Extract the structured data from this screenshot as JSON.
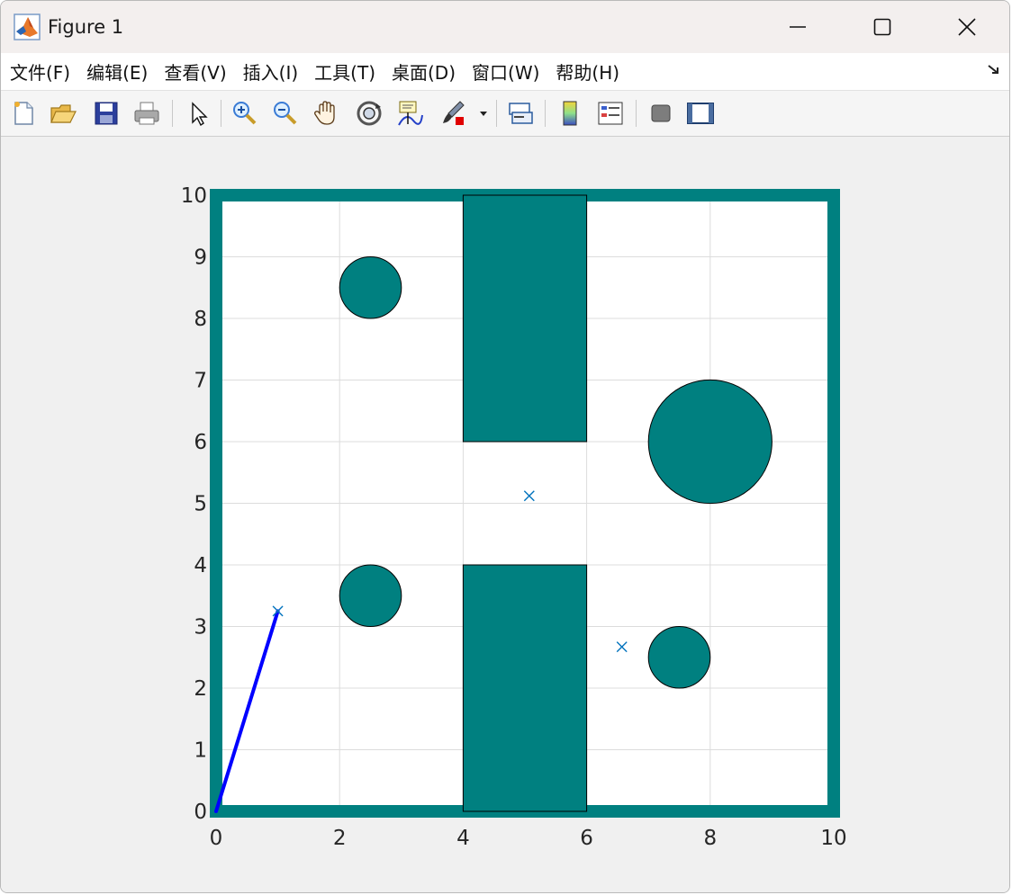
{
  "window": {
    "title": "Figure 1",
    "controls": {
      "minimize": "minimize",
      "maximize": "maximize",
      "close": "close"
    }
  },
  "menu": [
    {
      "label": "文件(F)"
    },
    {
      "label": "编辑(E)"
    },
    {
      "label": "查看(V)"
    },
    {
      "label": "插入(I)"
    },
    {
      "label": "工具(T)"
    },
    {
      "label": "桌面(D)"
    },
    {
      "label": "窗口(W)"
    },
    {
      "label": "帮助(H)"
    }
  ],
  "toolbar": [
    {
      "icon": "new-figure-icon"
    },
    {
      "icon": "open-file-icon"
    },
    {
      "icon": "save-icon"
    },
    {
      "icon": "print-icon"
    },
    {
      "icon": "edit-plot-arrow-icon"
    },
    {
      "icon": "zoom-in-icon"
    },
    {
      "icon": "zoom-out-icon"
    },
    {
      "icon": "pan-hand-icon"
    },
    {
      "icon": "rotate-3d-icon"
    },
    {
      "icon": "data-cursor-icon"
    },
    {
      "icon": "brush-icon"
    },
    {
      "icon": "link-plot-icon"
    },
    {
      "icon": "colorbar-icon"
    },
    {
      "icon": "legend-icon"
    },
    {
      "icon": "hide-plot-tools-icon"
    },
    {
      "icon": "show-plot-tools-icon"
    }
  ],
  "colors": {
    "obstacle": "#008080",
    "path": "#0000ff",
    "marker": "#0072bd",
    "grid": "#dcdcdc"
  },
  "chart_data": {
    "type": "scatter",
    "xlim": [
      0,
      10
    ],
    "ylim": [
      0,
      10
    ],
    "xticks": [
      "0",
      "2",
      "4",
      "6",
      "8",
      "10"
    ],
    "yticks": [
      "0",
      "1",
      "2",
      "3",
      "4",
      "5",
      "6",
      "7",
      "8",
      "9",
      "10"
    ],
    "grid": true,
    "border_obstacle": {
      "x": [
        0,
        10
      ],
      "y": [
        0,
        10
      ]
    },
    "rect_obstacles": [
      {
        "x": [
          4,
          6
        ],
        "y": [
          6,
          10
        ]
      },
      {
        "x": [
          4,
          6
        ],
        "y": [
          0,
          4
        ]
      }
    ],
    "circle_obstacles": [
      {
        "cx": 2.5,
        "cy": 8.5,
        "r": 0.5
      },
      {
        "cx": 2.5,
        "cy": 3.5,
        "r": 0.5
      },
      {
        "cx": 8,
        "cy": 6,
        "r": 1
      },
      {
        "cx": 7.5,
        "cy": 2.5,
        "r": 0.5
      }
    ],
    "markers": [
      {
        "x": 1.0,
        "y": 3.25
      },
      {
        "x": 5.07,
        "y": 5.12
      },
      {
        "x": 6.57,
        "y": 2.67
      }
    ],
    "path": {
      "x": [
        0,
        1.0
      ],
      "y": [
        0,
        3.25
      ]
    }
  }
}
